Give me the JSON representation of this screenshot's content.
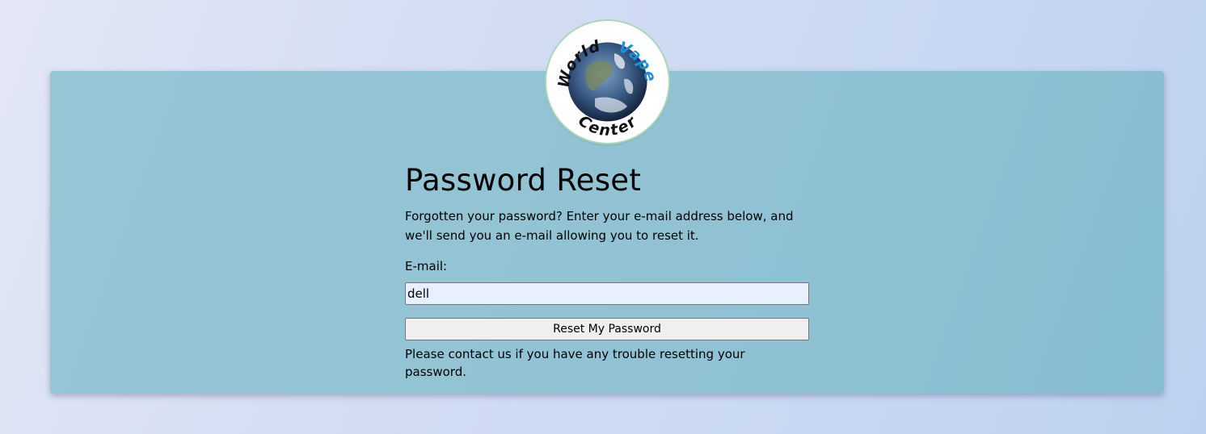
{
  "logo": {
    "line1_word1": "World",
    "line1_word2": "Vape",
    "line2": "Center",
    "accent_color": "#1d8fd8"
  },
  "page": {
    "title": "Password Reset",
    "description": "Forgotten your password? Enter your e-mail address below, and we'll send you an e-mail allowing you to reset it.",
    "email_label": "E-mail:",
    "email_value": "dell",
    "submit_label": "Reset My Password",
    "contact_note": "Please contact us if you have any trouble resetting your password."
  }
}
